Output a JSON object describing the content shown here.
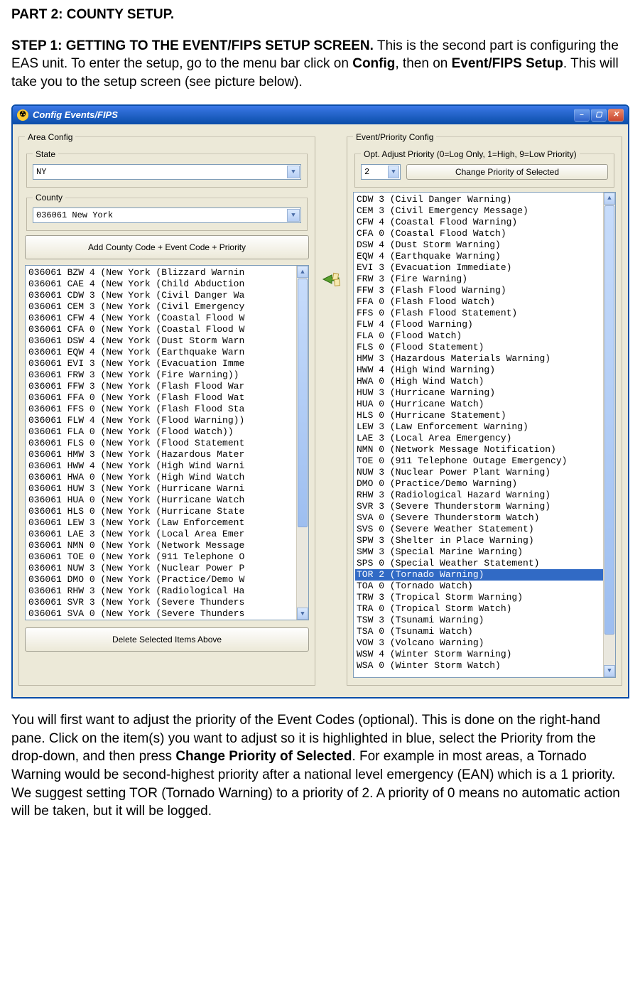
{
  "doc": {
    "part_line_bold": "PART 2:  COUNTY SETUP.",
    "p1_bold": "STEP 1:  GETTING TO THE EVENT/FIPS SETUP SCREEN.",
    "p1_a": "  This is the second part is configuring the EAS unit.  To enter the setup, go to the menu bar click on ",
    "p1_b1": "Config",
    "p1_c": ", then on ",
    "p1_b2": "Event/FIPS Setup",
    "p1_d": ". This will take you to the setup screen (see picture below).",
    "p2_a": "You will first want to adjust the priority of the Event Codes (optional).  This is done on the right-hand pane.  Click on the item(s) you want to adjust so it is highlighted in blue, select the Priority from the drop-down, and then press ",
    "p2_b": "Change Priority of Selected",
    "p2_c": ".   For example in most areas, a Tornado Warning would be second-highest priority after a national level emergency (EAN) which is a 1 priority.  We suggest setting TOR (Tornado Warning) to a priority of 2.  A priority of 0 means no automatic action will be taken, but it will be logged."
  },
  "window": {
    "title": "Config Events/FIPS",
    "icon_glyph": "☢",
    "area_legend": "Area Config",
    "state_legend": "State",
    "state_value": "NY",
    "county_legend": "County",
    "county_value": "036061 New York",
    "add_btn": "Add County Code + Event Code + Priority",
    "delete_btn": "Delete Selected Items Above",
    "evprio_legend": "Event/Priority Config",
    "opt_legend": "Opt. Adjust Priority (0=Log Only, 1=High, 9=Low Priority)",
    "prio_value": "2",
    "change_btn": "Change Priority of Selected"
  },
  "left_list": [
    "036061 BZW 4 (New York (Blizzard Warnin",
    "036061 CAE 4 (New York (Child Abduction",
    "036061 CDW 3 (New York (Civil Danger Wa",
    "036061 CEM 3 (New York (Civil Emergency",
    "036061 CFW 4 (New York (Coastal Flood W",
    "036061 CFA 0 (New York (Coastal Flood W",
    "036061 DSW 4 (New York (Dust Storm Warn",
    "036061 EQW 4 (New York (Earthquake Warn",
    "036061 EVI 3 (New York (Evacuation Imme",
    "036061 FRW 3 (New York (Fire Warning))",
    "036061 FFW 3 (New York (Flash Flood War",
    "036061 FFA 0 (New York (Flash Flood Wat",
    "036061 FFS 0 (New York (Flash Flood Sta",
    "036061 FLW 4 (New York (Flood Warning))",
    "036061 FLA 0 (New York (Flood Watch))",
    "036061 FLS 0 (New York (Flood Statement",
    "036061 HMW 3 (New York (Hazardous Mater",
    "036061 HWW 4 (New York (High Wind Warni",
    "036061 HWA 0 (New York (High Wind Watch",
    "036061 HUW 3 (New York (Hurricane Warni",
    "036061 HUA 0 (New York (Hurricane Watch",
    "036061 HLS 0 (New York (Hurricane State",
    "036061 LEW 3 (New York (Law Enforcement",
    "036061 LAE 3 (New York (Local Area Emer",
    "036061 NMN 0 (New York (Network Message",
    "036061 TOE 0 (New York (911 Telephone O",
    "036061 NUW 3 (New York (Nuclear Power P",
    "036061 DMO 0 (New York (Practice/Demo W",
    "036061 RHW 3 (New York (Radiological Ha",
    "036061 SVR 3 (New York (Severe Thunders",
    "036061 SVA 0 (New York (Severe Thunders"
  ],
  "right_list": [
    {
      "t": "CDW 3 (Civil Danger Warning)",
      "sel": false
    },
    {
      "t": "CEM 3 (Civil Emergency Message)",
      "sel": false
    },
    {
      "t": "CFW 4 (Coastal Flood Warning)",
      "sel": false
    },
    {
      "t": "CFA 0 (Coastal Flood Watch)",
      "sel": false
    },
    {
      "t": "DSW 4 (Dust Storm Warning)",
      "sel": false
    },
    {
      "t": "EQW 4 (Earthquake Warning)",
      "sel": false
    },
    {
      "t": "EVI 3 (Evacuation Immediate)",
      "sel": false
    },
    {
      "t": "FRW 3 (Fire Warning)",
      "sel": false
    },
    {
      "t": "FFW 3 (Flash Flood Warning)",
      "sel": false
    },
    {
      "t": "FFA 0 (Flash Flood Watch)",
      "sel": false
    },
    {
      "t": "FFS 0 (Flash Flood Statement)",
      "sel": false
    },
    {
      "t": "FLW 4 (Flood Warning)",
      "sel": false
    },
    {
      "t": "FLA 0 (Flood Watch)",
      "sel": false
    },
    {
      "t": "FLS 0 (Flood Statement)",
      "sel": false
    },
    {
      "t": "HMW 3 (Hazardous Materials Warning)",
      "sel": false
    },
    {
      "t": "HWW 4 (High Wind Warning)",
      "sel": false
    },
    {
      "t": "HWA 0 (High Wind Watch)",
      "sel": false
    },
    {
      "t": "HUW 3 (Hurricane Warning)",
      "sel": false
    },
    {
      "t": "HUA 0 (Hurricane Watch)",
      "sel": false
    },
    {
      "t": "HLS 0 (Hurricane Statement)",
      "sel": false
    },
    {
      "t": "LEW 3 (Law Enforcement Warning)",
      "sel": false
    },
    {
      "t": "LAE 3 (Local Area Emergency)",
      "sel": false
    },
    {
      "t": "NMN 0 (Network Message Notification)",
      "sel": false
    },
    {
      "t": "TOE 0 (911 Telephone Outage Emergency)",
      "sel": false
    },
    {
      "t": "NUW 3 (Nuclear Power Plant Warning)",
      "sel": false
    },
    {
      "t": "DMO 0 (Practice/Demo Warning)",
      "sel": false
    },
    {
      "t": "RHW 3 (Radiological Hazard Warning)",
      "sel": false
    },
    {
      "t": "SVR 3 (Severe Thunderstorm Warning)",
      "sel": false
    },
    {
      "t": "SVA 0 (Severe Thunderstorm Watch)",
      "sel": false
    },
    {
      "t": "SVS 0 (Severe Weather Statement)",
      "sel": false
    },
    {
      "t": "SPW 3 (Shelter in Place Warning)",
      "sel": false
    },
    {
      "t": "SMW 3 (Special Marine Warning)",
      "sel": false
    },
    {
      "t": "SPS 0 (Special Weather Statement)",
      "sel": false
    },
    {
      "t": "TOR 2 (Tornado Warning)",
      "sel": true
    },
    {
      "t": "TOA 0 (Tornado Watch)",
      "sel": false
    },
    {
      "t": "TRW 3 (Tropical Storm Warning)",
      "sel": false
    },
    {
      "t": "TRA 0 (Tropical Storm Watch)",
      "sel": false
    },
    {
      "t": "TSW 3 (Tsunami Warning)",
      "sel": false
    },
    {
      "t": "TSA 0 (Tsunami Watch)",
      "sel": false
    },
    {
      "t": "VOW 3 (Volcano Warning)",
      "sel": false
    },
    {
      "t": "WSW 4 (Winter Storm Warning)",
      "sel": false
    },
    {
      "t": "WSA 0 (Winter Storm Watch)",
      "sel": false
    }
  ]
}
